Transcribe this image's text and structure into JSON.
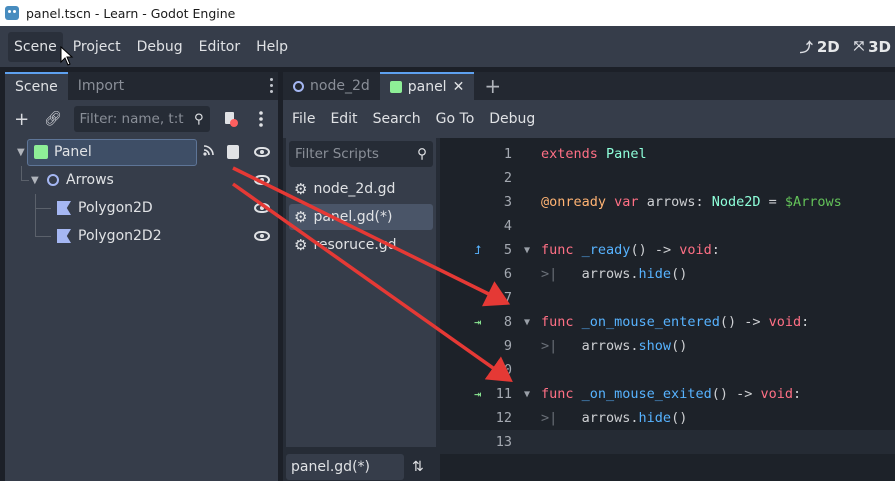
{
  "window": {
    "title": "panel.tscn - Learn - Godot Engine"
  },
  "menubar": {
    "items": [
      "Scene",
      "Project",
      "Debug",
      "Editor",
      "Help"
    ],
    "view_2d": "2D",
    "view_3d": "3D"
  },
  "left_dock": {
    "tabs": [
      "Scene",
      "Import"
    ],
    "filter_placeholder": "Filter: name, t:t",
    "tree": [
      {
        "label": "Panel",
        "icon": "panel-node-icon"
      },
      {
        "label": "Arrows",
        "icon": "node2d-icon"
      },
      {
        "label": "Polygon2D",
        "icon": "polygon2d-icon"
      },
      {
        "label": "Polygon2D2",
        "icon": "polygon2d-icon"
      }
    ]
  },
  "editor": {
    "tabs": [
      {
        "label": "node_2d",
        "icon": "node2d-icon"
      },
      {
        "label": "panel",
        "icon": "panel-node-icon"
      }
    ],
    "menu": [
      "File",
      "Edit",
      "Search",
      "Go To",
      "Debug"
    ],
    "filter_scripts_placeholder": "Filter Scripts",
    "scripts": [
      "node_2d.gd",
      "panel.gd(*)",
      "resoruce.gd"
    ],
    "current_script": "panel.gd(*)",
    "code_lines": [
      {
        "n": "1",
        "text": "extends Panel"
      },
      {
        "n": "2",
        "text": ""
      },
      {
        "n": "3",
        "text": "@onready var arrows: Node2D = $Arrows"
      },
      {
        "n": "4",
        "text": ""
      },
      {
        "n": "5",
        "text": "func _ready() -> void:"
      },
      {
        "n": "6",
        "text": "arrows.hide()"
      },
      {
        "n": "7",
        "text": ""
      },
      {
        "n": "8",
        "text": "func _on_mouse_entered() -> void:"
      },
      {
        "n": "9",
        "text": "arrows.show()"
      },
      {
        "n": "10",
        "text": ""
      },
      {
        "n": "11",
        "text": "func _on_mouse_exited() -> void:"
      },
      {
        "n": "12",
        "text": "arrows.hide()"
      },
      {
        "n": "13",
        "text": ""
      }
    ]
  },
  "colors": {
    "accent": "#5ea1f0",
    "keyword": "#ff7085",
    "type": "#8effda",
    "annotation": "#ffb373",
    "function": "#57b3ff",
    "annotation_arrow": "#e53935"
  }
}
